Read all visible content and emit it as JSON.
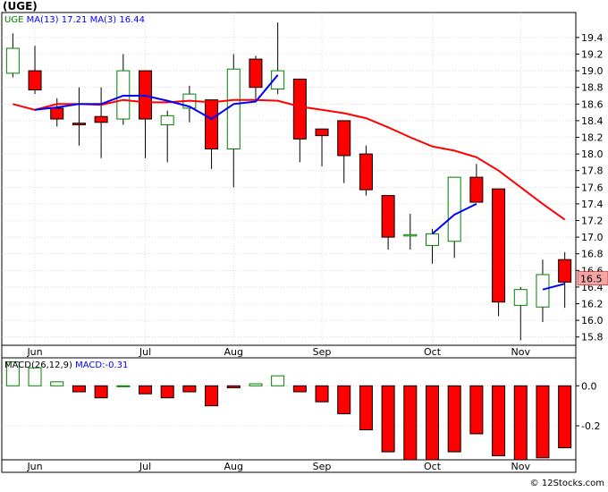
{
  "page": {
    "title": "(UGE)",
    "credit": "© 12Stocks.com"
  },
  "colors": {
    "up": "#008000",
    "down": "#ff0000",
    "ma13": "#ff0000",
    "ma3": "#0000ff",
    "grid": "#c8c8c8",
    "badge": "#f4a6a6"
  },
  "chart_data": [
    {
      "type": "candlestick",
      "legend": {
        "symbol": "UGE",
        "ma13_label": "MA(13)",
        "ma13_value": "17.21",
        "ma3_label": "MA(3)",
        "ma3_value": "16.44"
      },
      "ylim": [
        15.7,
        19.7
      ],
      "yticks": [
        15.8,
        16.0,
        16.2,
        16.4,
        16.6,
        16.8,
        17.0,
        17.2,
        17.4,
        17.6,
        17.8,
        18.0,
        18.2,
        18.4,
        18.6,
        18.8,
        19.0,
        19.2,
        19.4
      ],
      "ytick_labels": [
        "15.8",
        "16.0",
        "16.2",
        "16.4",
        "16.6",
        "16.8",
        "17.0",
        "17.2",
        "17.4",
        "17.6",
        "17.8",
        "18.0",
        "18.2",
        "18.4",
        "18.6",
        "18.8",
        "19.0",
        "19.2",
        "19.4"
      ],
      "last_price_label": "16.5",
      "last_price": 16.5,
      "x_months": [
        {
          "label": "Jun",
          "index": 1
        },
        {
          "label": "Jul",
          "index": 6
        },
        {
          "label": "Aug",
          "index": 10
        },
        {
          "label": "Sep",
          "index": 14
        },
        {
          "label": "Oct",
          "index": 19
        },
        {
          "label": "Nov",
          "index": 23
        }
      ],
      "candles": [
        {
          "o": 18.97,
          "h": 19.45,
          "l": 18.92,
          "c": 19.27
        },
        {
          "o": 19.0,
          "h": 19.3,
          "l": 18.72,
          "c": 18.77
        },
        {
          "o": 18.55,
          "h": 18.67,
          "l": 18.33,
          "c": 18.42
        },
        {
          "o": 18.37,
          "h": 18.8,
          "l": 18.1,
          "c": 18.35
        },
        {
          "o": 18.45,
          "h": 18.8,
          "l": 17.95,
          "c": 18.38
        },
        {
          "o": 18.42,
          "h": 19.2,
          "l": 18.35,
          "c": 19.0
        },
        {
          "o": 19.0,
          "h": 19.0,
          "l": 17.95,
          "c": 18.42
        },
        {
          "o": 18.35,
          "h": 18.52,
          "l": 17.9,
          "c": 18.46
        },
        {
          "o": 18.55,
          "h": 18.82,
          "l": 18.38,
          "c": 18.72
        },
        {
          "o": 18.65,
          "h": 18.65,
          "l": 17.82,
          "c": 18.06
        },
        {
          "o": 18.06,
          "h": 19.2,
          "l": 17.6,
          "c": 19.02
        },
        {
          "o": 19.14,
          "h": 19.18,
          "l": 18.62,
          "c": 18.8
        },
        {
          "o": 18.78,
          "h": 19.58,
          "l": 18.72,
          "c": 19.0
        },
        {
          "o": 18.9,
          "h": 18.9,
          "l": 17.9,
          "c": 18.18
        },
        {
          "o": 18.3,
          "h": 18.3,
          "l": 17.85,
          "c": 18.22
        },
        {
          "o": 18.4,
          "h": 18.4,
          "l": 17.65,
          "c": 17.98
        },
        {
          "o": 18.0,
          "h": 18.1,
          "l": 17.5,
          "c": 17.57
        },
        {
          "o": 17.5,
          "h": 17.5,
          "l": 16.85,
          "c": 17.0
        },
        {
          "o": 17.03,
          "h": 17.28,
          "l": 16.85,
          "c": 17.03
        },
        {
          "o": 16.9,
          "h": 17.1,
          "l": 16.68,
          "c": 17.04
        },
        {
          "o": 16.95,
          "h": 17.72,
          "l": 16.75,
          "c": 17.72
        },
        {
          "o": 17.72,
          "h": 17.88,
          "l": 17.42,
          "c": 17.42
        },
        {
          "o": 17.58,
          "h": 17.58,
          "l": 16.05,
          "c": 16.22
        },
        {
          "o": 16.18,
          "h": 16.4,
          "l": 15.76,
          "c": 16.37
        },
        {
          "o": 16.16,
          "h": 16.73,
          "l": 15.98,
          "c": 16.55
        },
        {
          "o": 16.73,
          "h": 16.82,
          "l": 16.15,
          "c": 16.46
        }
      ],
      "ma13": [
        18.6,
        null,
        null,
        null,
        null,
        null,
        null,
        null,
        null,
        null,
        null,
        null,
        null,
        null,
        null,
        null,
        null,
        null,
        null,
        null,
        null,
        null,
        null,
        null,
        null,
        17.21
      ],
      "ma13_line": [
        {
          "i": 0,
          "v": 18.6
        },
        {
          "i": 1,
          "v": 18.53
        },
        {
          "i": 2,
          "v": 18.6
        },
        {
          "i": 3,
          "v": 18.6
        },
        {
          "i": 4,
          "v": 18.59
        },
        {
          "i": 5,
          "v": 18.65
        },
        {
          "i": 6,
          "v": 18.62
        },
        {
          "i": 7,
          "v": 18.62
        },
        {
          "i": 8,
          "v": 18.64
        },
        {
          "i": 9,
          "v": 18.62
        },
        {
          "i": 10,
          "v": 18.65
        },
        {
          "i": 11,
          "v": 18.65
        },
        {
          "i": 12,
          "v": 18.64
        },
        {
          "i": 13,
          "v": 18.57
        },
        {
          "i": 14,
          "v": 18.53
        },
        {
          "i": 15,
          "v": 18.49
        },
        {
          "i": 16,
          "v": 18.43
        },
        {
          "i": 17,
          "v": 18.32
        },
        {
          "i": 18,
          "v": 18.2
        },
        {
          "i": 19,
          "v": 18.09
        },
        {
          "i": 20,
          "v": 18.04
        },
        {
          "i": 21,
          "v": 17.96
        },
        {
          "i": 22,
          "v": 17.8
        },
        {
          "i": 23,
          "v": 17.6
        },
        {
          "i": 24,
          "v": 17.4
        },
        {
          "i": 25,
          "v": 17.21
        }
      ],
      "ma3_line": [
        {
          "i": 0,
          "v": null
        },
        {
          "i": 1,
          "v": 18.53
        },
        {
          "i": 2,
          "v": 18.56
        },
        {
          "i": 3,
          "v": 18.6
        },
        {
          "i": 4,
          "v": 18.6
        },
        {
          "i": 5,
          "v": 18.7
        },
        {
          "i": 6,
          "v": 18.7
        },
        {
          "i": 7,
          "v": 18.64
        },
        {
          "i": 8,
          "v": 18.57
        },
        {
          "i": 9,
          "v": 18.42
        },
        {
          "i": 10,
          "v": 18.6
        },
        {
          "i": 11,
          "v": 18.63
        },
        {
          "i": 12,
          "v": 18.95
        },
        {
          "i": 13,
          "v": null
        },
        {
          "i": 14,
          "v": null
        },
        {
          "i": 15,
          "v": null
        },
        {
          "i": 16,
          "v": null
        },
        {
          "i": 17,
          "v": null
        },
        {
          "i": 18,
          "v": null
        },
        {
          "i": 19,
          "v": 17.04
        },
        {
          "i": 20,
          "v": 17.27
        },
        {
          "i": 21,
          "v": 17.4
        },
        {
          "i": 22,
          "v": null
        },
        {
          "i": 23,
          "v": null
        },
        {
          "i": 24,
          "v": 16.37
        },
        {
          "i": 25,
          "v": 16.44
        }
      ]
    },
    {
      "type": "bar",
      "legend": {
        "label": "MACD(26,12,9)",
        "value_label": "MACD:-0.31"
      },
      "ylim": [
        -0.37,
        0.14
      ],
      "yticks": [
        0.0,
        -0.2
      ],
      "ytick_labels": [
        "0.0",
        "-0.2"
      ],
      "x_months": [
        {
          "label": "Jun",
          "index": 1
        },
        {
          "label": "Jul",
          "index": 6
        },
        {
          "label": "Aug",
          "index": 10
        },
        {
          "label": "Sep",
          "index": 14
        },
        {
          "label": "Oct",
          "index": 19
        },
        {
          "label": "Nov",
          "index": 23
        }
      ],
      "values": [
        0.12,
        0.09,
        0.02,
        -0.03,
        -0.06,
        0.0,
        -0.04,
        -0.06,
        -0.03,
        -0.1,
        -0.01,
        0.01,
        0.05,
        -0.03,
        -0.08,
        -0.14,
        -0.22,
        -0.33,
        -0.37,
        -0.37,
        -0.33,
        -0.24,
        -0.35,
        -0.37,
        -0.36,
        -0.31
      ]
    }
  ]
}
